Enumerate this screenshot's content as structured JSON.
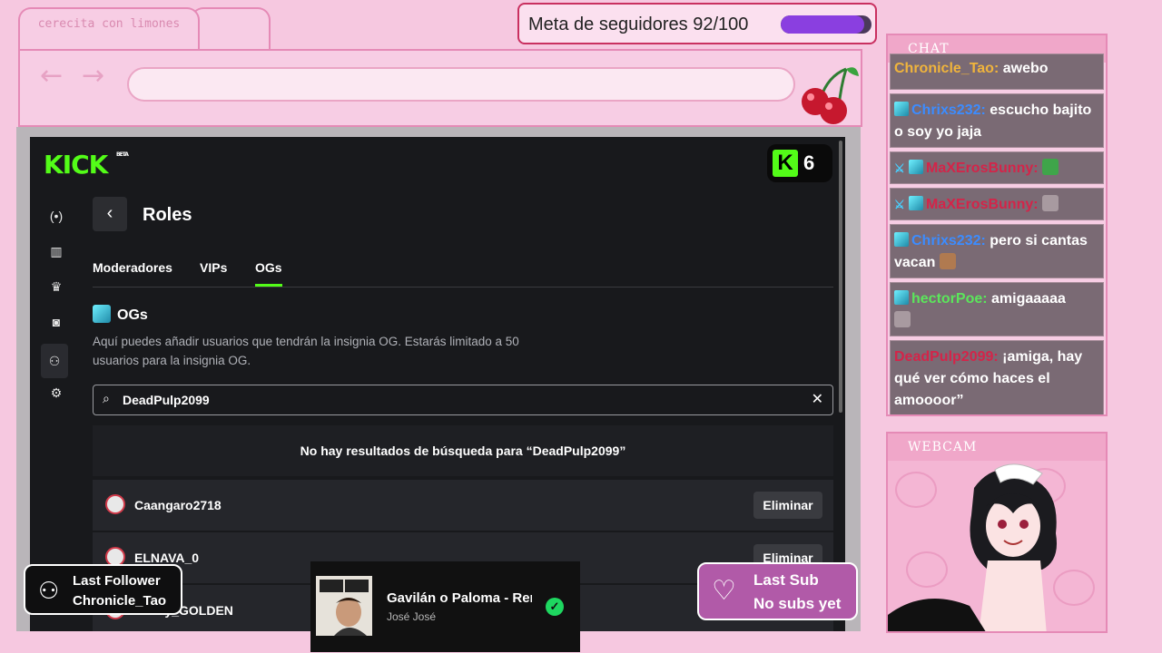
{
  "browser": {
    "tab_label": "cerecita con limones",
    "back_icon": "←",
    "forward_icon": "→",
    "address": ""
  },
  "goal": {
    "label": "Meta de seguidores 92/100",
    "progress": 0.92,
    "fill_color": "#8a3fe0"
  },
  "kick": {
    "logo": "KICK",
    "logo_sup": "BETA",
    "badge_letter": "K",
    "badge_count": "6",
    "accent_color": "#53fc18",
    "sidebar_icons": [
      "broadcast-icon",
      "chart-icon",
      "trophy-icon",
      "camera-icon",
      "users-icon",
      "gear-icon"
    ],
    "back_label": "‹",
    "page_title": "Roles",
    "tabs": [
      {
        "label": "Moderadores"
      },
      {
        "label": "VIPs"
      },
      {
        "label": "OGs"
      }
    ],
    "active_tab": "OGs",
    "og_section_title": "OGs",
    "og_description": "Aquí puedes añadir usuarios que tendrán la insignia OG. Estarás limitado a 50 usuarios para la insignia OG.",
    "search_value": "DeadPulp2099",
    "search_icon": "⌕",
    "clear_icon": "✕",
    "no_results": "No hay resultados de búsqueda para “DeadPulp2099”",
    "rows": [
      {
        "name": "Caangaro2718",
        "action": "Eliminar"
      },
      {
        "name": "ELNAVA_0",
        "action": "Eliminar"
      },
      {
        "name": "danny_GOLDEN",
        "action": ""
      }
    ]
  },
  "chat": {
    "title": "CHAT",
    "messages": [
      {
        "user": "Chronicle_Tao:",
        "text": " awebo"
      },
      {
        "user": "Chrixs232:",
        "text": " escucho bajito o soy yo jaja"
      },
      {
        "user": "MaXErosBunny:",
        "text": ""
      },
      {
        "user": "MaXErosBunny:",
        "text": ""
      },
      {
        "user": "Chrixs232:",
        "text": " pero si cantas vacan"
      },
      {
        "user": "hectorPoe:",
        "text": " amigaaaaa"
      },
      {
        "user": "DeadPulp2099:",
        "text": " ¡amiga, hay qué ver cómo haces el amoooor”"
      }
    ]
  },
  "webcam": {
    "title": "WEBCAM"
  },
  "follower": {
    "label": "Last Follower",
    "name": "Chronicle_Tao"
  },
  "music": {
    "song": "Gavilán o Paloma - Rem",
    "artist": "José José"
  },
  "sub": {
    "label": "Last Sub",
    "value": "No subs yet"
  }
}
